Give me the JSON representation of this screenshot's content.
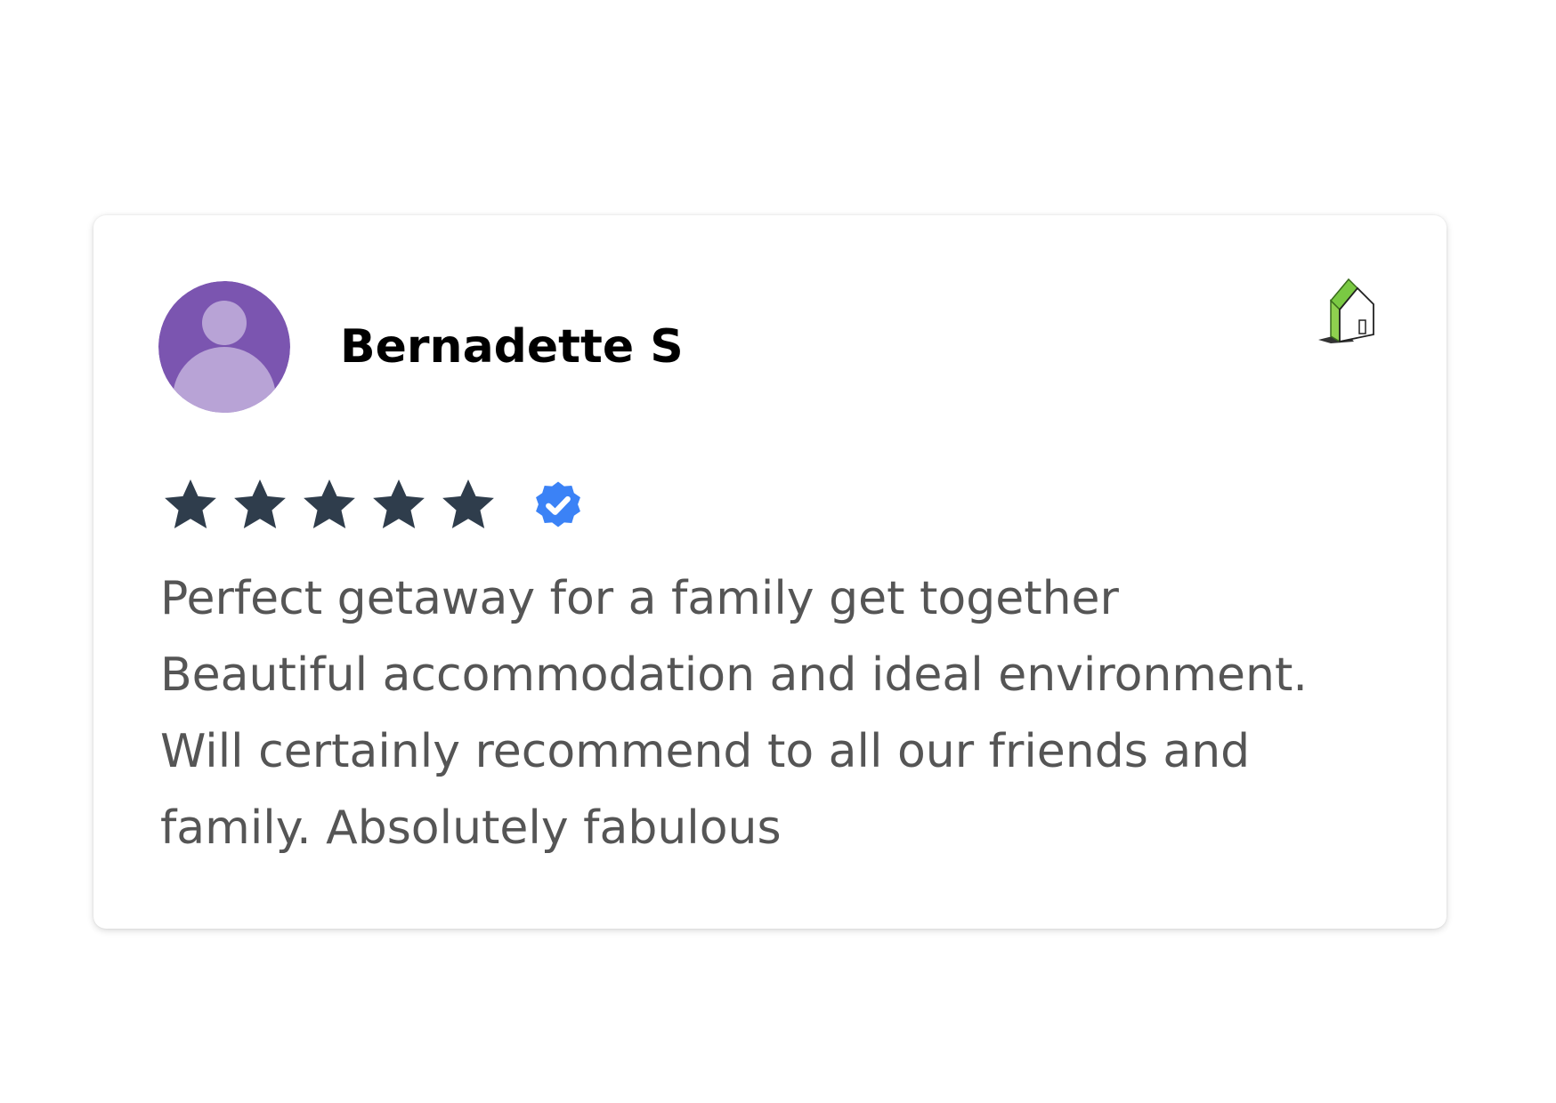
{
  "review": {
    "reviewer_name": "Bernadette S",
    "avatar_icon": "default-user-avatar-icon",
    "source_icon": "house-logo-icon",
    "rating": 5,
    "rating_max": 5,
    "verified_icon": "verified-badge-icon",
    "text_lines": [
      "Perfect getaway for a family get together",
      "Beautiful accommodation and ideal environment.",
      "Will certainly recommend to all our friends and",
      "family. Absolutely fabulous"
    ]
  },
  "colors": {
    "avatar_bg": "#7b55b0",
    "avatar_figure": "#b8a3d6",
    "star": "#2f3d4c",
    "verified": "#3b82f6",
    "text": "#555555",
    "name": "#000000"
  }
}
